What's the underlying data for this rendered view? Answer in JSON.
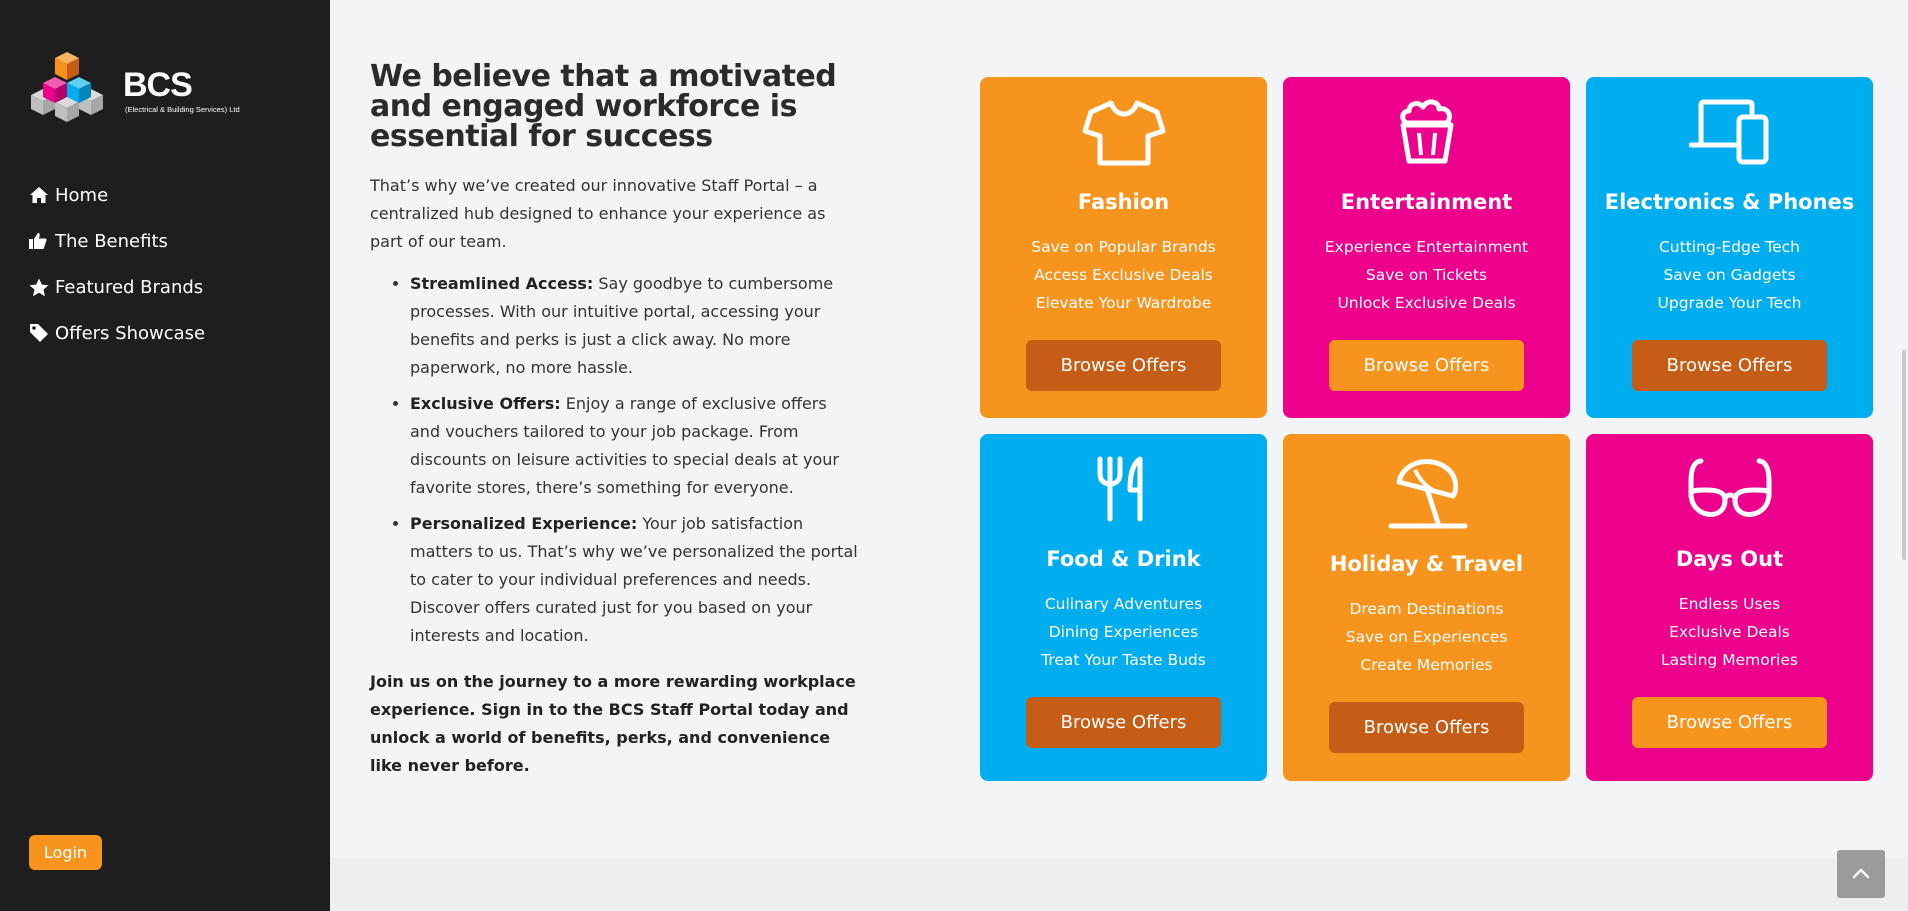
{
  "brand": {
    "logo_text": "BCS",
    "logo_subtitle": "(Electrical & Building Services) Ltd",
    "colors": {
      "orange": "#f7941d",
      "pink": "#ec008c",
      "blue": "#00aeef",
      "dark_orange": "#c65d16",
      "sidebar": "#1e1e1e"
    }
  },
  "sidebar": {
    "items": [
      {
        "label": "Home",
        "icon": "home-icon"
      },
      {
        "label": "The Benefits",
        "icon": "thumbs-up-icon"
      },
      {
        "label": "Featured Brands",
        "icon": "star-icon"
      },
      {
        "label": "Offers Showcase",
        "icon": "tag-icon"
      }
    ],
    "login_label": "Login"
  },
  "main": {
    "headline": "We believe that a motivated and engaged workforce is essential for success",
    "intro": "That’s why we’ve created our innovative Staff Portal – a centralized hub designed to enhance your experience as part of our team.",
    "bullets": [
      {
        "title": "Streamlined Access:",
        "text": " Say goodbye to cumbersome processes. With our intuitive portal, accessing your benefits and perks is just a click away. No more paperwork, no more hassle."
      },
      {
        "title": "Exclusive Offers:",
        "text": " Enjoy a range of exclusive offers and vouchers tailored to your job package. From discounts on leisure activities to special deals at your favorite stores, there’s something for everyone."
      },
      {
        "title": "Personalized Experience:",
        "text": " Your job satisfaction matters to us. That’s why we’ve personalized the portal to cater to your individual preferences and needs. Discover offers curated just for you based on your interests and location."
      }
    ],
    "closing": "Join us on the journey to a more rewarding workplace experience. Sign in to the BCS Staff Portal today and unlock a world of benefits, perks, and convenience like never before."
  },
  "cards": [
    {
      "title": "Fashion",
      "icon": "tshirt-icon",
      "lines": [
        "Save on Popular Brands",
        "Access Exclusive Deals",
        "Elevate Your Wardrobe"
      ],
      "button": "Browse Offers"
    },
    {
      "title": "Entertainment",
      "icon": "popcorn-icon",
      "lines": [
        "Experience Entertainment",
        "Save on Tickets",
        "Unlock Exclusive Deals"
      ],
      "button": "Browse Offers"
    },
    {
      "title": "Electronics & Phones",
      "icon": "devices-icon",
      "lines": [
        "Cutting-Edge Tech",
        "Save on Gadgets",
        "Upgrade Your Tech"
      ],
      "button": "Browse Offers"
    },
    {
      "title": "Food & Drink",
      "icon": "utensils-icon",
      "lines": [
        "Culinary Adventures",
        "Dining Experiences",
        "Treat Your Taste Buds"
      ],
      "button": "Browse Offers"
    },
    {
      "title": "Holiday & Travel",
      "icon": "beach-umbrella-icon",
      "lines": [
        "Dream Destinations",
        "Save on Experiences",
        "Create Memories"
      ],
      "button": "Browse Offers"
    },
    {
      "title": "Days Out",
      "icon": "glasses-icon",
      "lines": [
        "Endless Uses",
        "Exclusive Deals",
        "Lasting Memories"
      ],
      "button": "Browse Offers"
    }
  ]
}
